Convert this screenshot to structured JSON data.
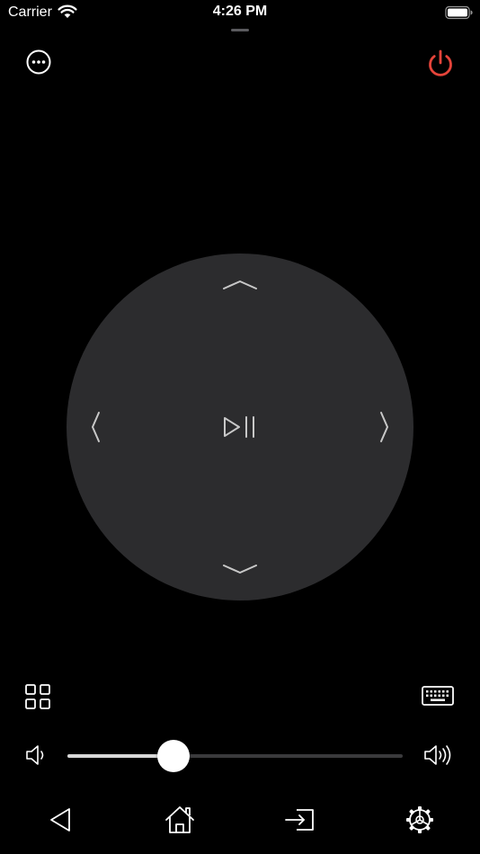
{
  "status_bar": {
    "carrier": "Carrier",
    "time": "4:26 PM",
    "wifi_icon": "wifi-icon",
    "battery_icon": "battery-full-icon"
  },
  "header": {
    "more_icon": "more-horizontal-circle-icon",
    "power_icon": "power-icon",
    "power_color": "#e5443a"
  },
  "dpad": {
    "background_color": "#2c2c2e",
    "up_icon": "chevron-up-icon",
    "down_icon": "chevron-down-icon",
    "left_icon": "chevron-left-icon",
    "right_icon": "chevron-right-icon",
    "center_icon": "play-pause-icon"
  },
  "controls": {
    "apps_icon": "grid-icon",
    "keyboard_icon": "keyboard-icon"
  },
  "volume": {
    "low_icon": "speaker-low-icon",
    "high_icon": "speaker-high-icon",
    "level": 0.316
  },
  "bottom_bar": {
    "back_icon": "back-triangle-icon",
    "home_icon": "home-icon",
    "input_icon": "input-source-icon",
    "settings_icon": "settings-gear-icon"
  }
}
